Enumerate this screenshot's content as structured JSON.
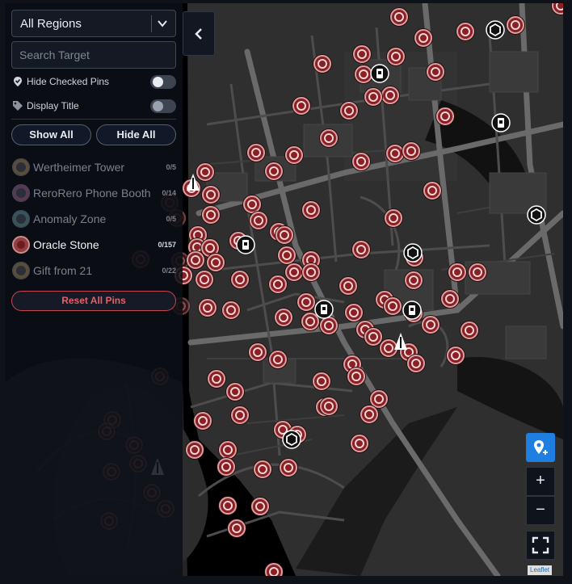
{
  "region_select": {
    "value": "All Regions"
  },
  "search": {
    "placeholder": "Search Target"
  },
  "options": {
    "hide_checked_label": "Hide Checked Pins",
    "display_title_label": "Display Title"
  },
  "buttons": {
    "show_all": "Show All",
    "hide_all": "Hide All",
    "reset": "Reset All Pins"
  },
  "categories": [
    {
      "name": "Wertheimer Tower",
      "count": "0/5",
      "icon": "tower-icon"
    },
    {
      "name": "ReroRero Phone Booth",
      "count": "0/14",
      "icon": "phone-booth-icon"
    },
    {
      "name": "Anomaly Zone",
      "count": "0/5",
      "icon": "anomaly-icon"
    },
    {
      "name": "Oracle Stone",
      "count": "0/157",
      "icon": "oracle-stone-icon"
    },
    {
      "name": "Gift from 21",
      "count": "0/22",
      "icon": "gift-icon"
    }
  ],
  "active_category": "Oracle Stone",
  "map_controls": {
    "zoom_in": "+",
    "zoom_out": "−"
  },
  "attribution": "Leaflet",
  "colors": {
    "pin_fill": "#8a1f24",
    "pin_ring": "#d9a1a1",
    "accent_blue": "#1f7fe0",
    "reset_red": "#e26168"
  }
}
